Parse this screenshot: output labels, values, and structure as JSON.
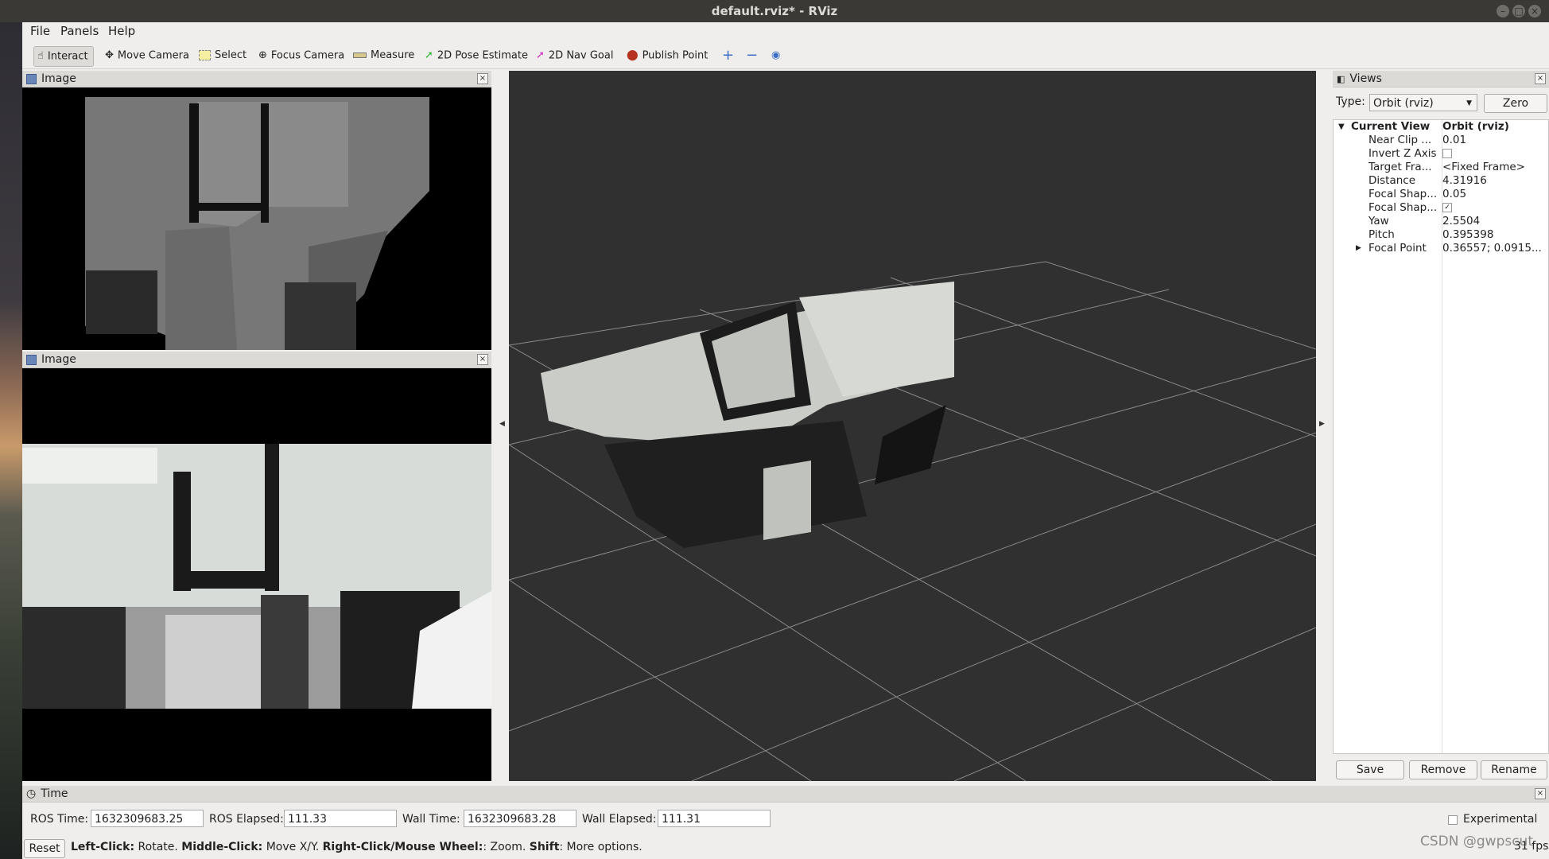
{
  "window": {
    "title": "default.rviz* - RViz"
  },
  "menu": {
    "file": "File",
    "panels": "Panels",
    "help": "Help"
  },
  "toolbar": {
    "interact": "Interact",
    "move_camera": "Move Camera",
    "select": "Select",
    "focus_camera": "Focus Camera",
    "measure": "Measure",
    "pose_estimate": "2D Pose Estimate",
    "nav_goal": "2D Nav Goal",
    "publish_point": "Publish Point"
  },
  "image_panels": [
    {
      "title": "Image"
    },
    {
      "title": "Image"
    }
  ],
  "views": {
    "title": "Views",
    "type_label": "Type:",
    "type_value": "Orbit (rviz)",
    "zero_label": "Zero",
    "current_view_label": "Current View",
    "current_view_value": "Orbit (rviz)",
    "properties": [
      {
        "key": "Near Clip ...",
        "value": "0.01"
      },
      {
        "key": "Invert Z Axis",
        "value": "",
        "checked": false
      },
      {
        "key": "Target Fra...",
        "value": "<Fixed Frame>"
      },
      {
        "key": "Distance",
        "value": "4.31916"
      },
      {
        "key": "Focal Shap...",
        "value": "0.05"
      },
      {
        "key": "Focal Shap...",
        "value": "",
        "checked": true
      },
      {
        "key": "Yaw",
        "value": "2.5504"
      },
      {
        "key": "Pitch",
        "value": "0.395398"
      },
      {
        "key": "Focal Point",
        "value": "0.36557; 0.0915..."
      }
    ],
    "save_label": "Save",
    "remove_label": "Remove",
    "rename_label": "Rename"
  },
  "time": {
    "title": "Time",
    "ros_time_label": "ROS Time:",
    "ros_time": "1632309683.25",
    "ros_elapsed_label": "ROS Elapsed:",
    "ros_elapsed": "111.33",
    "wall_time_label": "Wall Time:",
    "wall_time": "1632309683.28",
    "wall_elapsed_label": "Wall Elapsed:",
    "wall_elapsed": "111.31",
    "experimental_label": "Experimental"
  },
  "status": {
    "reset_label": "Reset",
    "left_click": "Left-Click:",
    "left_desc": " Rotate. ",
    "middle_click": "Middle-Click:",
    "middle_desc": " Move X/Y. ",
    "right_click": "Right-Click/Mouse Wheel:",
    "right_desc": ": Zoom. ",
    "shift": "Shift",
    "shift_desc": ": More options.",
    "fps": "31 fps"
  },
  "watermark": "CSDN @gwpscut"
}
